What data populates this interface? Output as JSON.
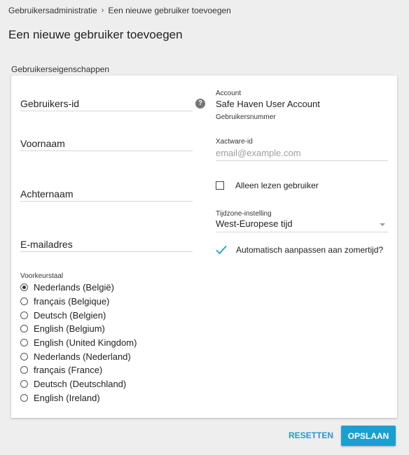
{
  "breadcrumb": {
    "parent": "Gebruikersadministratie",
    "separator": "›",
    "current": "Een nieuwe gebruiker toevoegen"
  },
  "page_title": "Een nieuwe gebruiker toevoegen",
  "section_title": "Gebruikerseigenschappen",
  "left_fields": {
    "user_id": "Gebruikers-id",
    "first_name": "Voornaam",
    "last_name": "Achternaam",
    "email": "E-mailadres"
  },
  "help_icon_glyph": "?",
  "language": {
    "title": "Voorkeurstaal",
    "selected_index": 0,
    "options": [
      "Nederlands (België)",
      "français (Belgique)",
      "Deutsch (Belgien)",
      "English (Belgium)",
      "English (United Kingdom)",
      "Nederlands (Nederland)",
      "français (France)",
      "Deutsch (Deutschland)",
      "English (Ireland)"
    ]
  },
  "account": {
    "label": "Account",
    "value": "Safe Haven User Account",
    "number_label": "Gebruikersnummer"
  },
  "xactware": {
    "label": "Xactware-id",
    "placeholder": "email@example.com"
  },
  "read_only": {
    "label": "Alleen lezen gebruiker",
    "checked": false
  },
  "timezone": {
    "label": "Tijdzone-instelling",
    "value": "West-Europese tijd"
  },
  "dst": {
    "label": "Automatisch aanpassen aan zomertijd?",
    "checked": true
  },
  "buttons": {
    "reset": "RESETTEN",
    "save": "OPSLAAN"
  },
  "colors": {
    "accent": "#1a9fd1",
    "background": "#eeeeee",
    "card": "#ffffff"
  }
}
